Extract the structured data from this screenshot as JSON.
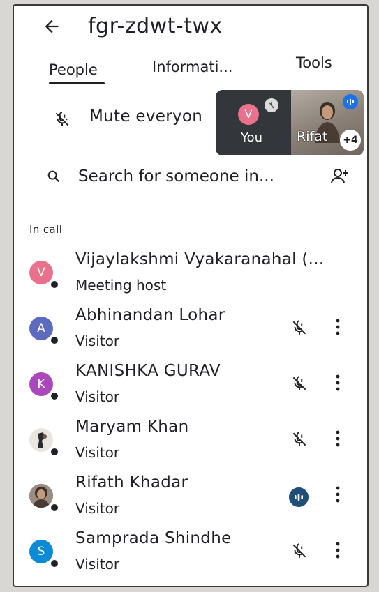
{
  "meeting": {
    "title": "fgr-zdwt-twx"
  },
  "tabs": [
    {
      "label": "People"
    },
    {
      "label": "Informati..."
    },
    {
      "label": "Tools"
    }
  ],
  "mute_all": {
    "label": "Mute everyon"
  },
  "pip": {
    "self_initial": "V",
    "self_label": "You",
    "other_label": "Rifat",
    "count": "+4"
  },
  "search": {
    "placeholder": "Search for someone in..."
  },
  "section": {
    "label": "In call"
  },
  "participants": [
    {
      "name": "Vijaylakshmi Vyakaranahal (...",
      "role": "Meeting host",
      "initial": "V",
      "color": "#e8718c",
      "status": "host"
    },
    {
      "name": "Abhinandan Lohar",
      "role": "Visitor",
      "initial": "A",
      "color": "#5c6bc0",
      "status": "muted"
    },
    {
      "name": "KANISHKA GURAV",
      "role": "Visitor",
      "initial": "K",
      "color": "#ab47bc",
      "status": "muted"
    },
    {
      "name": "Maryam Khan",
      "role": "Visitor",
      "initial": "",
      "color": "#e9e6e1",
      "status": "muted"
    },
    {
      "name": "Rifath Khadar",
      "role": "Visitor",
      "initial": "",
      "color": "#8d7f74",
      "status": "speaking"
    },
    {
      "name": "Samprada Shindhe",
      "role": "Visitor",
      "initial": "S",
      "color": "#0b8ad6",
      "status": "muted"
    }
  ],
  "colors": {
    "accent": "#1a73e8",
    "speaking": "#1f4e79",
    "text": "#202124"
  }
}
